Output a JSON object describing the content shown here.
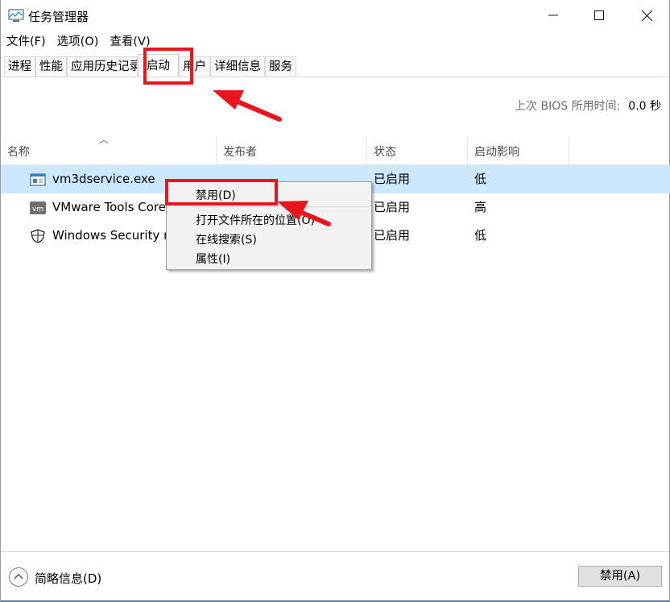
{
  "window": {
    "title": "任务管理器",
    "controls": {
      "minimize": "—",
      "maximize": "☐",
      "close": "✕"
    }
  },
  "menu": [
    "文件(F)",
    "选项(O)",
    "查看(V)"
  ],
  "tabs": [
    "进程",
    "性能",
    "应用历史记录",
    "启动",
    "用户",
    "详细信息",
    "服务"
  ],
  "active_tab": "启动",
  "bios": {
    "label": "上次 BIOS 所用时间:",
    "value": "0.0 秒"
  },
  "columns": [
    "名称",
    "发布者",
    "状态",
    "启动影响"
  ],
  "rows": [
    {
      "name": "vm3dservice.exe",
      "publisher": "",
      "status": "已启用",
      "impact": "低",
      "icon": "service-app-icon",
      "selected": true
    },
    {
      "name": "VMware Tools Core",
      "publisher": "",
      "status": "已启用",
      "impact": "高",
      "icon": "vmware-icon",
      "selected": false
    },
    {
      "name": "Windows Security n",
      "publisher": "",
      "status": "已启用",
      "impact": "低",
      "icon": "shield-icon",
      "selected": false
    }
  ],
  "context_menu": [
    "禁用(D)",
    "打开文件所在的位置(O)",
    "在线搜索(S)",
    "属性(I)"
  ],
  "footer": {
    "fewer_details": "简略信息(D)",
    "disable_button": "禁用(A)"
  },
  "colors": {
    "selection": "#cce8ff",
    "annotation": "#e8141e"
  }
}
